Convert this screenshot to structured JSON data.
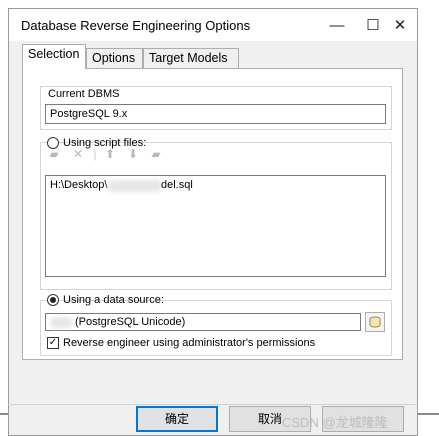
{
  "window": {
    "title": "Database Reverse Engineering Options",
    "minimize_glyph": "—",
    "maximize_glyph": "☐",
    "close_glyph": "✕"
  },
  "tabs": [
    {
      "label": "Selection",
      "active": true
    },
    {
      "label": "Options",
      "active": false
    },
    {
      "label": "Target Models",
      "active": false
    }
  ],
  "selection": {
    "current_dbms_label": "Current DBMS",
    "current_dbms_value": "PostgreSQL 9.x",
    "script_files_label": "Using script files:",
    "script_files_selected": false,
    "script_toolbar_icons": [
      "add-file-icon",
      "delete-icon",
      "move-up-icon",
      "move-down-icon",
      "add-folder-icon"
    ],
    "script_files": [
      {
        "prefix": "H:\\Desktop\\",
        "suffix": "del.sql"
      }
    ],
    "data_source_label": "Using a data source:",
    "data_source_selected": true,
    "data_source_value": "(PostgreSQL Unicode)",
    "admin_permissions_label": "Reverse engineer using administrator's permissions",
    "admin_permissions_checked": true
  },
  "buttons": {
    "ok": "确定",
    "cancel": "取消"
  },
  "watermark": "CSDN @龙城隆隆"
}
